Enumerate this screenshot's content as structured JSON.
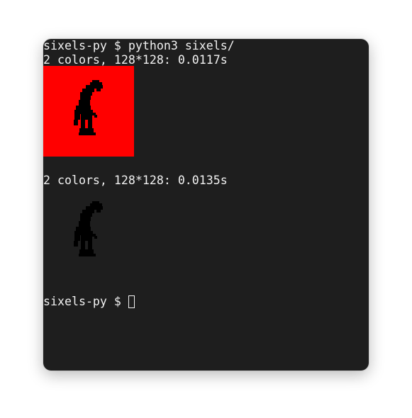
{
  "terminal": {
    "prompt": "sixels-py $ ",
    "command": "python3 sixels/",
    "outputs": [
      {
        "text": "2 colors, 128*128: 0.0117s",
        "background": "#ff0000",
        "figure_color": "#000000"
      },
      {
        "text": "2 colors, 128*128: 0.0135s",
        "background": "#1e1e1e",
        "figure_color": "#000000"
      }
    ],
    "final_prompt": "sixels-py $ "
  },
  "colors": {
    "terminal_bg": "#1e1e1e",
    "text": "#f2f2f2"
  }
}
